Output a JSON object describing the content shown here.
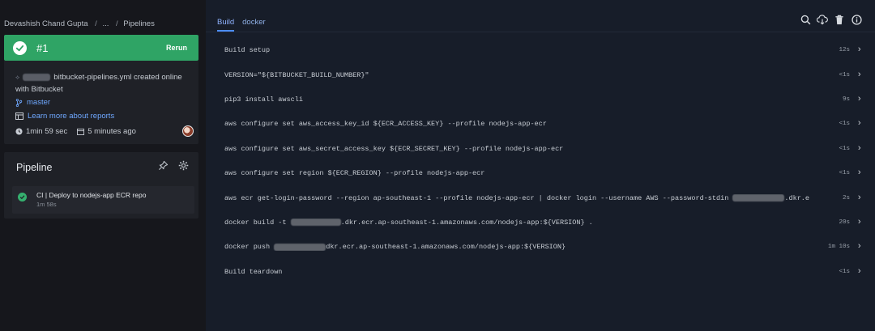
{
  "breadcrumb": {
    "user": "Devashish Chand Gupta",
    "ellipsis": "...",
    "page": "Pipelines",
    "separator": "/"
  },
  "build": {
    "number": "#1",
    "rerun_label": "Rerun",
    "commit_message": "bitbucket-pipelines.yml created online with Bitbucket",
    "branch": "master",
    "report_link": "Learn more about reports",
    "duration": "1min 59 sec",
    "started": "5 minutes ago",
    "status_color": "#2fa465"
  },
  "pipeline": {
    "title": "Pipeline",
    "step_name": "CI | Deploy to nodejs-app ECR repo",
    "step_duration": "1m 58s"
  },
  "tabs": [
    {
      "label": "Build"
    },
    {
      "label": "docker"
    }
  ],
  "toolbar_icons": [
    "search-icon",
    "cloud-download-icon",
    "trash-icon",
    "info-icon"
  ],
  "steps": [
    {
      "pre": "Build setup",
      "post": "",
      "time": "12s"
    },
    {
      "pre": "VERSION=\"${BITBUCKET_BUILD_NUMBER}\"",
      "post": "",
      "time": "<1s"
    },
    {
      "pre": "pip3 install awscli",
      "post": "",
      "time": "9s"
    },
    {
      "pre": "aws configure set aws_access_key_id ${ECR_ACCESS_KEY} --profile nodejs-app-ecr",
      "post": "",
      "time": "<1s"
    },
    {
      "pre": "aws configure set aws_secret_access_key ${ECR_SECRET_KEY} --profile nodejs-app-ecr",
      "post": "",
      "time": "<1s"
    },
    {
      "pre": "aws configure set region ${ECR_REGION} --profile nodejs-app-ecr",
      "post": "",
      "time": "<1s"
    },
    {
      "pre": "aws ecr get-login-password --region ap-southeast-1 --profile nodejs-app-ecr | docker login --username AWS --password-stdin ",
      "post": ".dkr.ecr....",
      "time": "2s"
    },
    {
      "pre": "docker build -t ",
      "post": ".dkr.ecr.ap-southeast-1.amazonaws.com/nodejs-app:${VERSION} .",
      "time": "20s"
    },
    {
      "pre": "docker push ",
      "post": "dkr.ecr.ap-southeast-1.amazonaws.com/nodejs-app:${VERSION}",
      "time": "1m 10s"
    },
    {
      "pre": "Build teardown",
      "post": "",
      "time": "<1s"
    }
  ]
}
